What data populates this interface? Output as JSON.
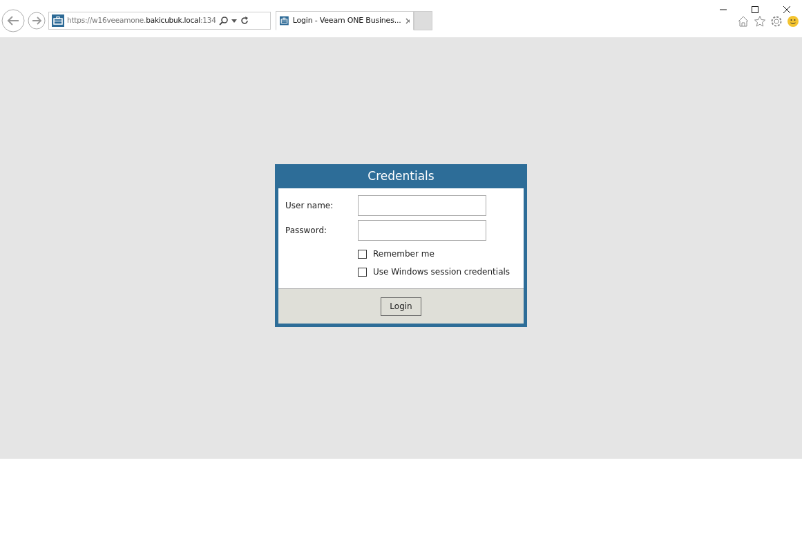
{
  "browser": {
    "address": {
      "scheme": "https://w16veeamone.",
      "host": "bakicubuk.local",
      "rest": ":134"
    },
    "tabs": [
      {
        "title": "Login - Veeam ONE Busines...",
        "selected": true
      }
    ]
  },
  "dialog": {
    "title": "Credentials",
    "fields": [
      {
        "label": "User name:"
      },
      {
        "label": "Password:"
      }
    ],
    "options": [
      {
        "label": "Remember me",
        "checked": false
      },
      {
        "label": "Use Windows session credentials",
        "checked": false
      }
    ],
    "button": "Login"
  }
}
